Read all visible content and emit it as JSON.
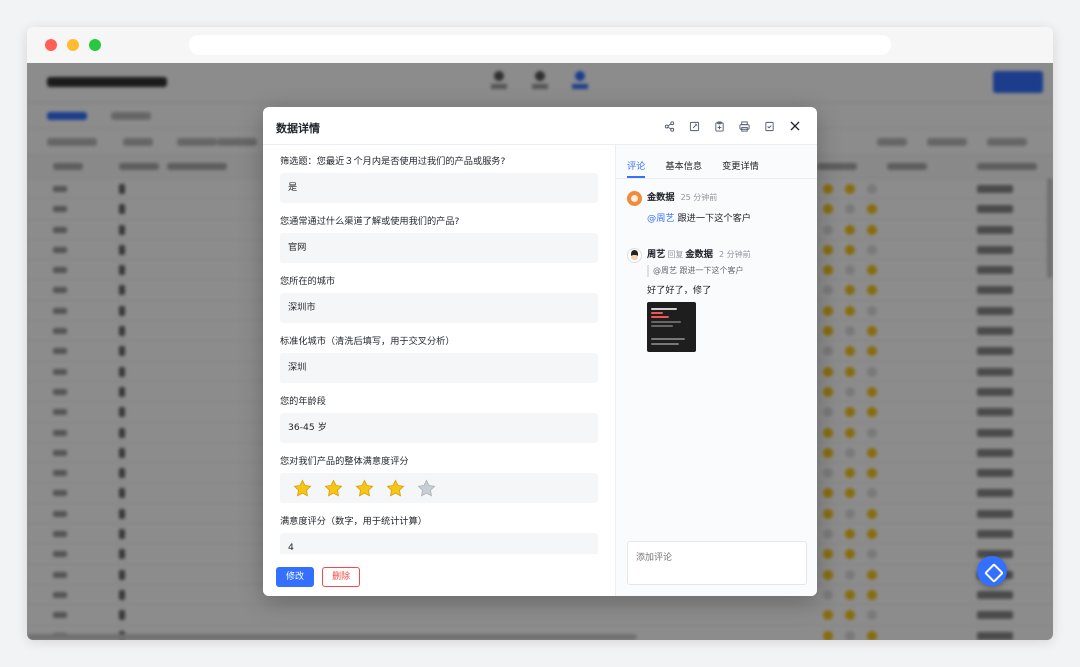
{
  "modal": {
    "title": "数据详情",
    "header_icons": [
      "share-icon",
      "edit-icon",
      "copy-icon",
      "print-icon",
      "check-doc-icon",
      "close-icon"
    ],
    "fields": [
      {
        "label": "筛选题：您最近３个月内是否使用过我们的产品或服务?",
        "value": "是"
      },
      {
        "label": "您通常通过什么渠道了解或使用我们的产品?",
        "value": "官网"
      },
      {
        "label": "您所在的城市",
        "value": "深圳市"
      },
      {
        "label": "标准化城市（清洗后填写，用于交叉分析）",
        "value": "深圳"
      },
      {
        "label": "您的年龄段",
        "value": "36-45 岁"
      },
      {
        "label": "您对我们产品的整体满意度评分",
        "rating": 4,
        "rating_max": 5
      },
      {
        "label": "满意度评分（数字，用于统计计算）",
        "value": "4"
      }
    ],
    "buttons": {
      "edit": "修改",
      "delete": "删除"
    },
    "tabs": [
      "评论",
      "基本信息",
      "变更详情"
    ],
    "active_tab": 0,
    "comments": [
      {
        "author": "金数据",
        "time": "25 分钟前",
        "mention": "@周艺",
        "text": " 跟进一下这个客户"
      },
      {
        "author": "周艺",
        "reply_word": "回复",
        "reply_to": "金数据",
        "time": "2 分钟前",
        "quote": "@周艺 跟进一下这个客户",
        "text": "好了好了，修了",
        "has_image": true
      }
    ],
    "comment_placeholder": "添加评论"
  },
  "colors": {
    "accent": "#3370ff",
    "danger": "#f54a45",
    "star": "#f5c518",
    "star_empty": "#c9cdd4"
  }
}
